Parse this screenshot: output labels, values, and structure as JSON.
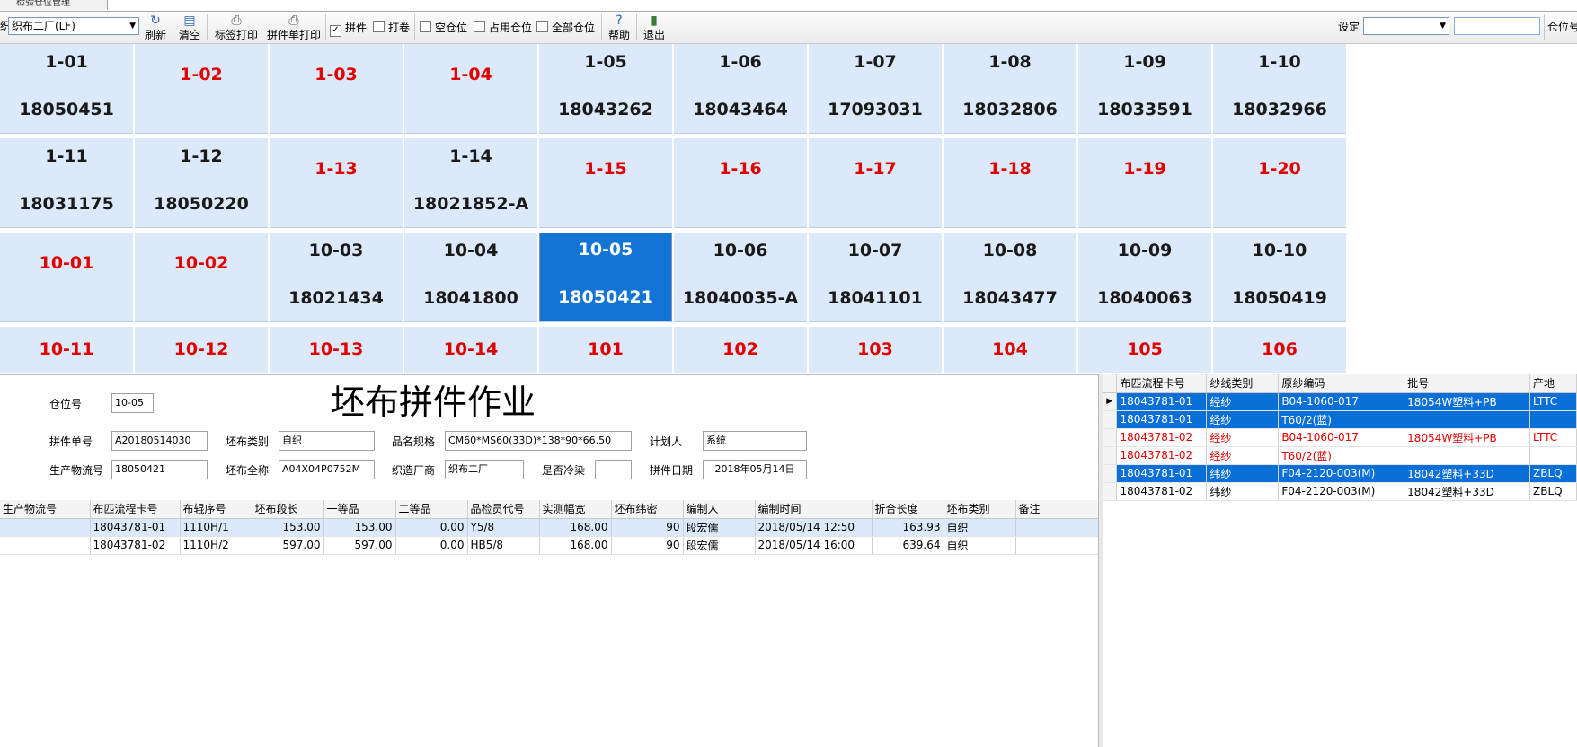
{
  "tab": {
    "title": "检验仓位管理"
  },
  "toolbar": {
    "left_cut_label": "织",
    "factory_select": "织布二厂(LF)",
    "buttons": {
      "refresh": "刷新",
      "clear": "清空",
      "label_print": "标签打印",
      "splice_print": "拼件单打印",
      "help": "帮助",
      "exit": "退出"
    },
    "checks": [
      {
        "label": "拼件",
        "checked": true
      },
      {
        "label": "打卷",
        "checked": false
      },
      {
        "label": "空仓位",
        "checked": false
      },
      {
        "label": "占用仓位",
        "checked": false
      },
      {
        "label": "全部仓位",
        "checked": false
      }
    ],
    "setting_label": "设定",
    "setting_value": "",
    "setting_input": "",
    "right_cut_label": "仓位号"
  },
  "bins": [
    {
      "code": "1-01",
      "num": "18050451"
    },
    {
      "code": "1-02",
      "num": ""
    },
    {
      "code": "1-03",
      "num": ""
    },
    {
      "code": "1-04",
      "num": ""
    },
    {
      "code": "1-05",
      "num": "18043262"
    },
    {
      "code": "1-06",
      "num": "18043464"
    },
    {
      "code": "1-07",
      "num": "17093031"
    },
    {
      "code": "1-08",
      "num": "18032806"
    },
    {
      "code": "1-09",
      "num": "18033591"
    },
    {
      "code": "1-10",
      "num": "18032966"
    },
    {
      "code": "1-11",
      "num": "18031175"
    },
    {
      "code": "1-12",
      "num": "18050220"
    },
    {
      "code": "1-13",
      "num": ""
    },
    {
      "code": "1-14",
      "num": "18021852-A"
    },
    {
      "code": "1-15",
      "num": ""
    },
    {
      "code": "1-16",
      "num": ""
    },
    {
      "code": "1-17",
      "num": ""
    },
    {
      "code": "1-18",
      "num": ""
    },
    {
      "code": "1-19",
      "num": ""
    },
    {
      "code": "1-20",
      "num": ""
    },
    {
      "code": "10-01",
      "num": ""
    },
    {
      "code": "10-02",
      "num": ""
    },
    {
      "code": "10-03",
      "num": "18021434"
    },
    {
      "code": "10-04",
      "num": "18041800"
    },
    {
      "code": "10-05",
      "num": "18050421",
      "selected": true
    },
    {
      "code": "10-06",
      "num": "18040035-A"
    },
    {
      "code": "10-07",
      "num": "18041101"
    },
    {
      "code": "10-08",
      "num": "18043477"
    },
    {
      "code": "10-09",
      "num": "18040063"
    },
    {
      "code": "10-10",
      "num": "18050419"
    },
    {
      "code": "10-11",
      "num": ""
    },
    {
      "code": "10-12",
      "num": ""
    },
    {
      "code": "10-13",
      "num": ""
    },
    {
      "code": "10-14",
      "num": ""
    },
    {
      "code": "101",
      "num": ""
    },
    {
      "code": "102",
      "num": ""
    },
    {
      "code": "103",
      "num": ""
    },
    {
      "code": "104",
      "num": ""
    },
    {
      "code": "105",
      "num": ""
    },
    {
      "code": "106",
      "num": ""
    }
  ],
  "form": {
    "title": "坯布拼件作业",
    "bin_no": {
      "label": "仓位号",
      "value": "10-05"
    },
    "splice_no": {
      "label": "拼件单号",
      "value": "A20180514030"
    },
    "cloth_type": {
      "label": "坯布类别",
      "value": "自织"
    },
    "spec": {
      "label": "品名规格",
      "value": "CM60*MS60(33D)*138*90*66.50"
    },
    "planner": {
      "label": "计划人",
      "value": "系统"
    },
    "prod_flow": {
      "label": "生产物流号",
      "value": "18050421"
    },
    "full_name": {
      "label": "坯布全称",
      "value": "A04X04P0752M"
    },
    "weaver": {
      "label": "织造厂商",
      "value": "织布二厂"
    },
    "cold_dye": {
      "label": "是否冷染",
      "value": ""
    },
    "splice_date": {
      "label": "拼件日期",
      "value": "2018年05月14日"
    }
  },
  "table_main": {
    "headers": [
      "生产物流号",
      "布匹流程卡号",
      "布辊序号",
      "坯布段长",
      "一等品",
      "二等品",
      "品检员代号",
      "实测幅宽",
      "坯布纬密",
      "编制人",
      "编制时间",
      "折合长度",
      "坯布类别",
      "备注"
    ],
    "rows": [
      [
        "",
        "18043781-01",
        "1110H/1",
        "153.00",
        "153.00",
        "0.00",
        "Y5/8",
        "168.00",
        "90",
        "段宏儒",
        "2018/05/14 12:50",
        "163.93",
        "自织",
        ""
      ],
      [
        "",
        "18043781-02",
        "1110H/2",
        "597.00",
        "597.00",
        "0.00",
        "HB5/8",
        "168.00",
        "90",
        "段宏儒",
        "2018/05/14 16:00",
        "639.64",
        "自织",
        ""
      ]
    ]
  },
  "table_side": {
    "headers": [
      "布匹流程卡号",
      "纱线类别",
      "原纱编码",
      "批号",
      "产地"
    ],
    "rows": [
      {
        "cells": [
          "18043781-01",
          "经纱",
          "B04-1060-017",
          "18054W塑料+PB",
          "LTTC"
        ],
        "style": "blue",
        "current": true
      },
      {
        "cells": [
          "18043781-01",
          "经纱",
          "T60/2(蓝)",
          "",
          ""
        ],
        "style": "blue"
      },
      {
        "cells": [
          "18043781-02",
          "经纱",
          "B04-1060-017",
          "18054W塑料+PB",
          "LTTC"
        ],
        "style": "red"
      },
      {
        "cells": [
          "18043781-02",
          "经纱",
          "T60/2(蓝)",
          "",
          ""
        ],
        "style": "red"
      },
      {
        "cells": [
          "18043781-01",
          "纬纱",
          "F04-2120-003(M)",
          "18042塑料+33D",
          "ZBLQ"
        ],
        "style": "blue"
      },
      {
        "cells": [
          "18043781-02",
          "纬纱",
          "F04-2120-003(M)",
          "18042塑料+33D",
          "ZBLQ"
        ],
        "style": "normal"
      }
    ]
  },
  "colors": {
    "empty_bin": "#e00000",
    "selected_bin": "#1275d6",
    "bin_bg": "#dce9fa",
    "row_blue": "#0a6fd6"
  }
}
